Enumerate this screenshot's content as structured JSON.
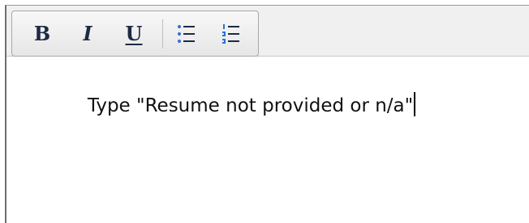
{
  "toolbar": {
    "bold_label": "B",
    "italic_label": "I",
    "underline_label": "U",
    "bulleted_list_icon": "bulleted-list-icon",
    "numbered_list_icon": "numbered-list-icon"
  },
  "editor": {
    "content": "Type \"Resume not provided or n/a\""
  },
  "colors": {
    "toolbar_icon": "#1e2a44",
    "list_accent": "#2f6fd6"
  }
}
